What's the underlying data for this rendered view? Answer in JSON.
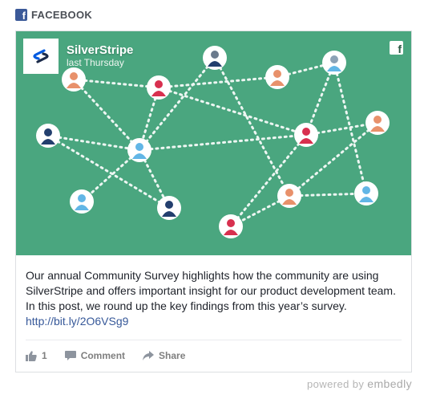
{
  "header": {
    "label": "FACEBOOK",
    "fb_glyph": "f"
  },
  "post": {
    "brand": "SilverStripe",
    "time": "last Thursday",
    "fb_glyph": "f",
    "text": "Our annual Community Survey highlights how the community are using SilverStripe and offers important insight for our product development team. In this post, we round up the key findings from this year’s survey.",
    "link": "http://bit.ly/2O6VSg9"
  },
  "actions": {
    "like_count": "1",
    "comment_label": "Comment",
    "share_label": "Share"
  },
  "footer": {
    "powered_prefix": "powered by",
    "powered_brand": "embedly"
  },
  "colors": {
    "hero_bg": "#4aa67f",
    "facebook_blue": "#3b5998",
    "link": "#365899",
    "avatar_orange": "#e8916b",
    "avatar_red": "#d8304f",
    "avatar_navy": "#233f6e",
    "avatar_blue": "#62b6e6",
    "avatar_gray": "#6a7a8c"
  },
  "icons": [
    "facebook-icon",
    "silverstripe-logo-icon",
    "like-icon",
    "comment-icon",
    "share-icon"
  ]
}
